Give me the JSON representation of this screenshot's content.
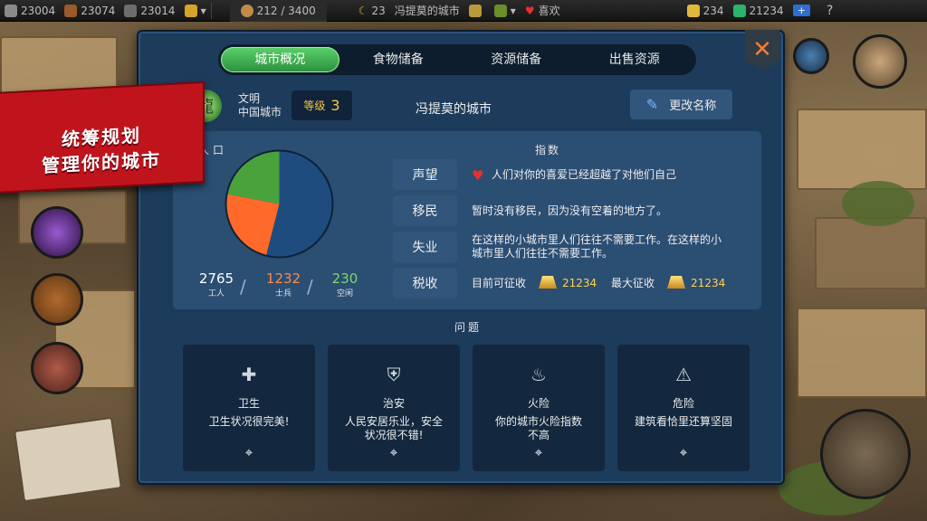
{
  "topbar": {
    "res1": "23004",
    "res2": "23074",
    "res3": "23014",
    "population": "212 / 3400",
    "city_level": "23",
    "city_name": "冯提莫的城市",
    "mood": "喜欢",
    "gold": "234",
    "gems": "21234",
    "plus": "+",
    "help": "?"
  },
  "tabs": [
    "城市概况",
    "食物储备",
    "资源储备",
    "出售资源"
  ],
  "banner": {
    "line1": "统筹规划",
    "line2": "管理你的城市"
  },
  "civilization": {
    "label": "文明",
    "value": "中国城市"
  },
  "level": {
    "label": "等级",
    "value": "3"
  },
  "city_name": "冯提莫的城市",
  "rename_label": "更改名称",
  "population": {
    "label": "人口",
    "workers": {
      "value": "2765",
      "label": "工人"
    },
    "soldiers": {
      "value": "1232",
      "label": "士兵"
    },
    "idle": {
      "value": "230",
      "label": "空闲"
    },
    "colors": {
      "workers": "#1e4c7e",
      "soldiers": "#ff6a2a",
      "idle": "#4aa23d"
    }
  },
  "indices": {
    "label": "指数",
    "reputation": {
      "label": "声望",
      "text": "人们对你的喜爱已经超越了对他们自己"
    },
    "immigration": {
      "label": "移民",
      "text": "暂时没有移民，因为没有空着的地方了。"
    },
    "unemployment": {
      "label": "失业",
      "text1": "在这样的小城市里人们往往不需要工作。在这样的小",
      "text2": "城市里人们往往不需要工作。"
    },
    "tax": {
      "label": "税收",
      "current_label": "目前可征收",
      "current_value": "21234",
      "max_label": "最大征收",
      "max_value": "21234"
    }
  },
  "problems": {
    "label": "问题",
    "items": [
      {
        "icon": "cross-icon",
        "title": "卫生",
        "desc1": "卫生状况很完美!",
        "desc2": ""
      },
      {
        "icon": "shield-icon",
        "title": "治安",
        "desc1": "人民安居乐业，安全",
        "desc2": "状况很不错!"
      },
      {
        "icon": "fire-icon",
        "title": "火险",
        "desc1": "你的城市火险指数",
        "desc2": "不高"
      },
      {
        "icon": "danger-icon",
        "title": "危险",
        "desc1": "建筑看恰里还算坚固",
        "desc2": ""
      }
    ]
  },
  "colors": {
    "panel": "#1d3c5c",
    "accent_green": "#2b8f3c",
    "banner_red": "#c0141d",
    "gold_text": "#ffd34a"
  }
}
